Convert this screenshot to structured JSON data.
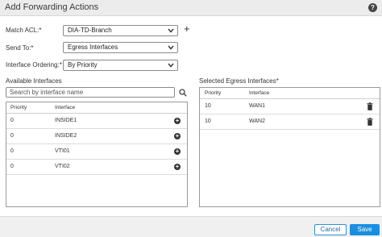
{
  "dialog": {
    "title": "Add Forwarding Actions",
    "help_icon": "question-circle-icon"
  },
  "form": {
    "match_acl": {
      "label": "Match ACL:*",
      "value": "DIA-TD-Branch"
    },
    "send_to": {
      "label": "Send To:*",
      "value": "Egress Interfaces"
    },
    "interface_ordering": {
      "label": "Interface Ordering:*",
      "value": "By Priority"
    }
  },
  "available": {
    "label": "Available Interfaces",
    "search_placeholder": "Search by interface name",
    "columns": {
      "priority": "Priority",
      "interface": "Interface"
    },
    "rows": [
      {
        "priority": "0",
        "interface": "INSIDE1"
      },
      {
        "priority": "0",
        "interface": "INSIDE2"
      },
      {
        "priority": "0",
        "interface": "VTI01"
      },
      {
        "priority": "0",
        "interface": "VTI02"
      }
    ]
  },
  "selected": {
    "label": "Selected Egress Interfaces*",
    "columns": {
      "priority": "Priority",
      "interface": "Interface"
    },
    "rows": [
      {
        "priority": "10",
        "interface": "WAN1"
      },
      {
        "priority": "10",
        "interface": "WAN2"
      }
    ]
  },
  "footer": {
    "cancel_label": "Cancel",
    "save_label": "Save"
  },
  "colors": {
    "accent": "#1a8fe0",
    "header_bg": "#ececec",
    "footer_bg": "#f0f0f0"
  }
}
